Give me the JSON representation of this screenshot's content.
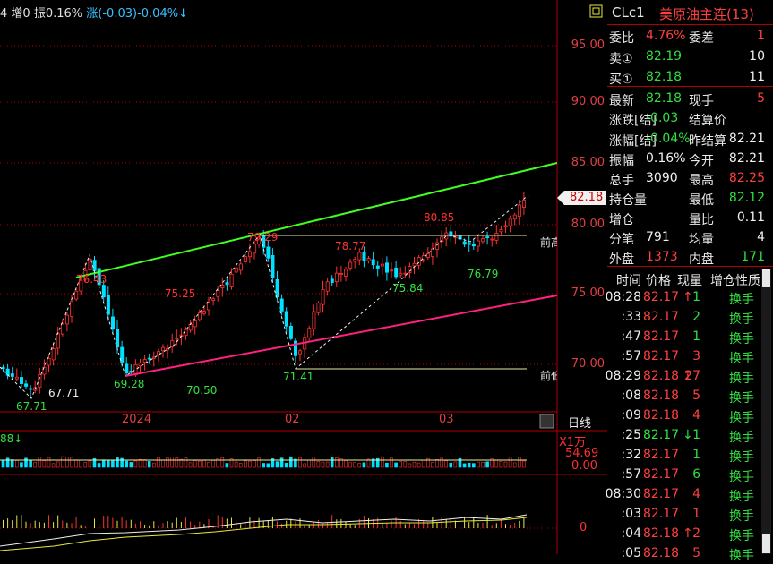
{
  "header": {
    "prefix": "4",
    "oi_change": "增0",
    "amplitude": "振0.16%",
    "change": "涨(-0.03)-0.04%↓"
  },
  "price_axis": [
    "95.00",
    "90.00",
    "85.00",
    "80.00",
    "75.00",
    "70.00"
  ],
  "date_axis": [
    "2024",
    "02",
    "03"
  ],
  "current_price_tag": "82.18",
  "price_annotations": {
    "a_67_71": "67.71",
    "b_67_71": "67.71",
    "c_76_43": "76.43",
    "d_69_28": "69.28",
    "e_75_25": "75.25",
    "f_70_50": "70.50",
    "g_79_29": "79.29",
    "h_71_41": "71.41",
    "i_78_77": "78.77",
    "j_75_84": "75.84",
    "k_80_85": "80.85",
    "l_76_79": "76.79",
    "prev_high": "前高",
    "prev_low": "前低"
  },
  "period_label": "日线",
  "volume": {
    "header": "88↓",
    "unit": "X1万",
    "value1": "54.69",
    "value2": "0.00"
  },
  "macd": {
    "zero": "0"
  },
  "quote": {
    "symbol": "CLc1",
    "name": "美原油主连(13)",
    "rows": [
      {
        "l1": "委比",
        "v1": "4.76%",
        "c1": "red",
        "l2": "委差",
        "v2": "1",
        "c2": "red"
      },
      {
        "l1": "卖①",
        "v1": "82.19",
        "c1": "grn",
        "l2": "",
        "v2": "10",
        "c2": "wht"
      },
      {
        "l1": "买①",
        "v1": "82.18",
        "c1": "grn",
        "l2": "",
        "v2": "11",
        "c2": "wht"
      },
      {
        "l1": "最新",
        "v1": "82.18",
        "c1": "grn",
        "l2": "现手",
        "v2": "5",
        "c2": "red"
      },
      {
        "l1": "涨跌[结]",
        "v1": "-0.03",
        "c1": "grn",
        "l2": "结算价",
        "v2": "",
        "c2": "wht"
      },
      {
        "l1": "涨幅[结]",
        "v1": "-0.04%",
        "c1": "grn",
        "l2": "昨结算",
        "v2": "82.21",
        "c2": "wht"
      },
      {
        "l1": "振幅",
        "v1": "0.16%",
        "c1": "wht",
        "l2": "今开",
        "v2": "82.21",
        "c2": "wht"
      },
      {
        "l1": "总手",
        "v1": "3090",
        "c1": "wht",
        "l2": "最高",
        "v2": "82.25",
        "c2": "red"
      },
      {
        "l1": "持仓量",
        "v1": "",
        "c1": "wht",
        "l2": "最低",
        "v2": "82.12",
        "c2": "grn"
      },
      {
        "l1": "增仓",
        "v1": "",
        "c1": "wht",
        "l2": "量比",
        "v2": "0.11",
        "c2": "wht"
      },
      {
        "l1": "分笔",
        "v1": "791",
        "c1": "wht",
        "l2": "均量",
        "v2": "4",
        "c2": "wht"
      },
      {
        "l1": "外盘",
        "v1": "1373",
        "c1": "red",
        "l2": "内盘",
        "v2": "171",
        "c2": "grn"
      }
    ]
  },
  "ticks": {
    "headers": [
      "时间",
      "价格",
      "现量",
      "增仓",
      "性质"
    ],
    "rows": [
      {
        "t": "08:28",
        "p": "82.17",
        "arrow": "↑",
        "ac": "red",
        "v": "1",
        "vc": "grn",
        "k": "换手"
      },
      {
        "t": ":33",
        "p": "82.17",
        "arrow": "",
        "ac": "red",
        "v": "2",
        "vc": "grn",
        "k": "换手"
      },
      {
        "t": ":47",
        "p": "82.17",
        "arrow": "",
        "ac": "red",
        "v": "1",
        "vc": "grn",
        "k": "换手"
      },
      {
        "t": ":57",
        "p": "82.17",
        "arrow": "",
        "ac": "red",
        "v": "3",
        "vc": "red",
        "k": "换手"
      },
      {
        "t": "08:29",
        "p": "82.18",
        "arrow": "↑",
        "ac": "red",
        "v": "27",
        "vc": "red",
        "k": "换手"
      },
      {
        "t": ":08",
        "p": "82.18",
        "arrow": "",
        "ac": "red",
        "v": "5",
        "vc": "red",
        "k": "换手"
      },
      {
        "t": ":09",
        "p": "82.18",
        "arrow": "",
        "ac": "red",
        "v": "4",
        "vc": "red",
        "k": "换手"
      },
      {
        "t": ":25",
        "p": "82.17",
        "arrow": "↓",
        "ac": "grn",
        "v": "1",
        "vc": "grn",
        "k": "换手"
      },
      {
        "t": ":32",
        "p": "82.17",
        "arrow": "",
        "ac": "red",
        "v": "1",
        "vc": "grn",
        "k": "换手"
      },
      {
        "t": ":57",
        "p": "82.17",
        "arrow": "",
        "ac": "red",
        "v": "6",
        "vc": "grn",
        "k": "换手"
      },
      {
        "t": "08:30",
        "p": "82.17",
        "arrow": "",
        "ac": "red",
        "v": "4",
        "vc": "red",
        "k": "换手"
      },
      {
        "t": ":03",
        "p": "82.17",
        "arrow": "",
        "ac": "red",
        "v": "1",
        "vc": "red",
        "k": "换手"
      },
      {
        "t": ":04",
        "p": "82.18",
        "arrow": "↑",
        "ac": "red",
        "v": "2",
        "vc": "red",
        "k": "换手"
      },
      {
        "t": ":05",
        "p": "82.18",
        "arrow": "",
        "ac": "red",
        "v": "5",
        "vc": "red",
        "k": "换手"
      }
    ]
  },
  "colors": {
    "up": "#ff3030",
    "down": "#00e0ff",
    "upper_channel": "#40ff20",
    "lower_channel": "#ff2080",
    "grid": "#b00000"
  }
}
